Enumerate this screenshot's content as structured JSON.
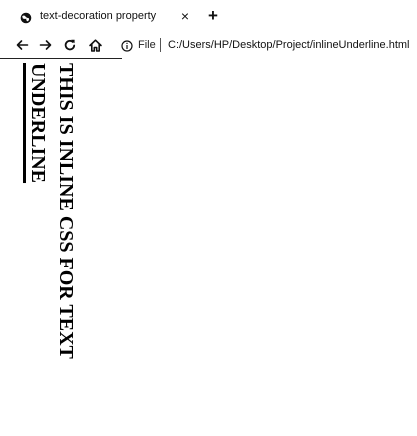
{
  "tab": {
    "title": "text-decoration property",
    "close_glyph": "×",
    "favicon": "globe-icon"
  },
  "new_tab_glyph": "+",
  "toolbar": {
    "back_icon": "arrow-left-icon",
    "forward_icon": "arrow-right-icon",
    "reload_icon": "reload-icon",
    "home_icon": "home-icon",
    "info_icon": "info-icon",
    "file_label": "File",
    "url": "C:/Users/HP/Desktop/Project/inlineUnderline.html"
  },
  "content": {
    "line1": "THIS IS INLINE CSS FOR TEXT",
    "line2": "UNDERLINE"
  }
}
